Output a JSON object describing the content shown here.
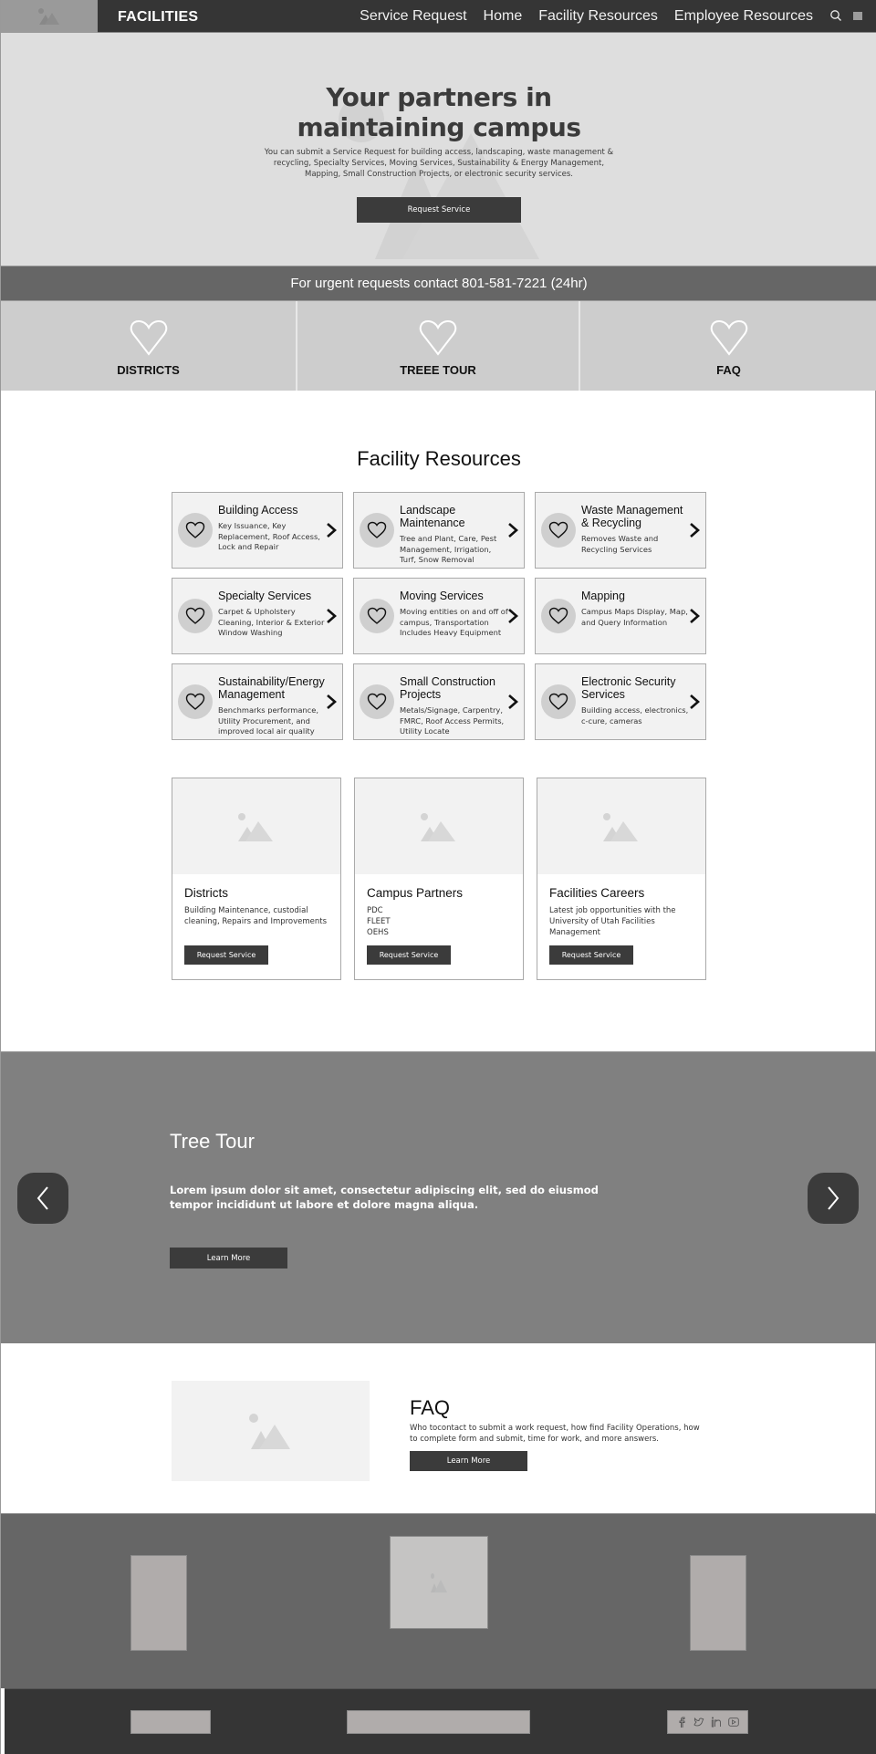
{
  "nav": {
    "brand": "FACILITIES",
    "links": [
      "Service Request",
      "Home",
      "Facility Resources",
      "Employee Resources"
    ],
    "search_icon": "search-icon",
    "menu_icon": "menu-icon"
  },
  "hero": {
    "title_line1": "Your partners in",
    "title_line2": "maintaining campus",
    "description": "You can submit a Service Request for building access, landscaping, waste management & recycling, Specialty Services, Moving Services, Sustainability & Energy Management, Mapping, Small Construction Projects, or electronic security services.",
    "button": "Request Service"
  },
  "urgent": {
    "text": "For urgent requests contact 801-581-7221 (24hr)"
  },
  "tiles": [
    {
      "label": "DISTRICTS",
      "icon": "heart-icon"
    },
    {
      "label": "TREEE TOUR",
      "icon": "heart-icon"
    },
    {
      "label": "FAQ",
      "icon": "heart-icon"
    }
  ],
  "facility_resources": {
    "title": "Facility Resources",
    "items": [
      {
        "name": "Building Access",
        "desc": "Key Issuance, Key Replacement, Roof Access, Lock and Repair"
      },
      {
        "name": "Landscape Maintenance",
        "desc": "Tree and Plant, Care, Pest Management, Irrigation, Turf, Snow Removal"
      },
      {
        "name": "Waste Management & Recycling",
        "desc": "Removes Waste and Recycling Services"
      },
      {
        "name": "Specialty Services",
        "desc": "Carpet & Upholstery Cleaning, Interior & Exterior Window Washing"
      },
      {
        "name": "Moving Services",
        "desc": "Moving entities on and off of campus, Transportation Includes Heavy Equipment"
      },
      {
        "name": "Mapping",
        "desc": "Campus Maps Display, Map, and Query Information"
      },
      {
        "name": "Sustainability/Energy Management",
        "desc": "Benchmarks performance, Utility Procurement, and improved local air quality"
      },
      {
        "name": "Small Construction Projects",
        "desc": "Metals/Signage, Carpentry, FMRC, Roof Access Permits, Utility Locate"
      },
      {
        "name": "Electronic Security Services",
        "desc": "Building access, electronics, c-cure, cameras"
      }
    ]
  },
  "feature_cards": [
    {
      "title": "Districts",
      "desc": "Building Maintenance, custodial cleaning, Repairs and Improvements",
      "button": "Request Service"
    },
    {
      "title": "Campus Partners",
      "desc": "PDC\nFLEET\nOEHS",
      "button": "Request Service"
    },
    {
      "title": "Facilities Careers",
      "desc": "Latest job opportunities with the University of Utah Facilities Management",
      "button": "Request Service"
    }
  ],
  "tree_tour": {
    "title": "Tree Tour",
    "description": "Lorem ipsum dolor sit amet, consectetur adipiscing elit, sed do eiusmod tempor incididunt ut labore et dolore magna aliqua.",
    "button": "Learn More"
  },
  "faq": {
    "title": "FAQ",
    "description": "Who tocontact to submit a work request, how find Facility Operations, how to complete form and submit, time for work, and more answers.",
    "button": "Learn More"
  },
  "footer": {
    "social": [
      "facebook-icon",
      "twitter-icon",
      "linkedin-icon",
      "youtube-icon"
    ]
  }
}
